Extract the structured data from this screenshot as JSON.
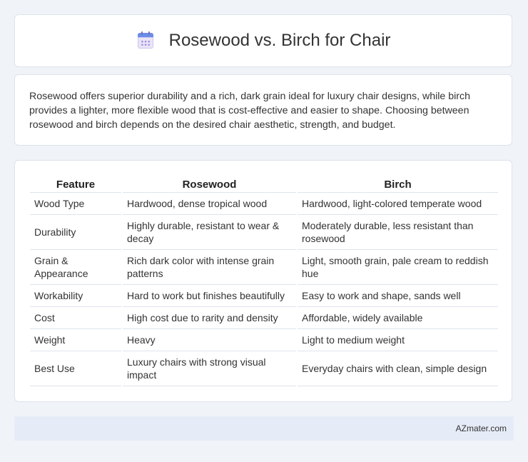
{
  "header": {
    "title": "Rosewood vs. Birch for Chair",
    "icon": "calendar-icon"
  },
  "summary": "Rosewood offers superior durability and a rich, dark grain ideal for luxury chair designs, while birch provides a lighter, more flexible wood that is cost-effective and easier to shape. Choosing between rosewood and birch depends on the desired chair aesthetic, strength, and budget.",
  "table": {
    "headers": [
      "Feature",
      "Rosewood",
      "Birch"
    ],
    "rows": [
      [
        "Wood Type",
        "Hardwood, dense tropical wood",
        "Hardwood, light-colored temperate wood"
      ],
      [
        "Durability",
        "Highly durable, resistant to wear & decay",
        "Moderately durable, less resistant than rosewood"
      ],
      [
        "Grain & Appearance",
        "Rich dark color with intense grain patterns",
        "Light, smooth grain, pale cream to reddish hue"
      ],
      [
        "Workability",
        "Hard to work but finishes beautifully",
        "Easy to work and shape, sands well"
      ],
      [
        "Cost",
        "High cost due to rarity and density",
        "Affordable, widely available"
      ],
      [
        "Weight",
        "Heavy",
        "Light to medium weight"
      ],
      [
        "Best Use",
        "Luxury chairs with strong visual impact",
        "Everyday chairs with clean, simple design"
      ]
    ]
  },
  "footer": {
    "site": "AZmater.com"
  }
}
